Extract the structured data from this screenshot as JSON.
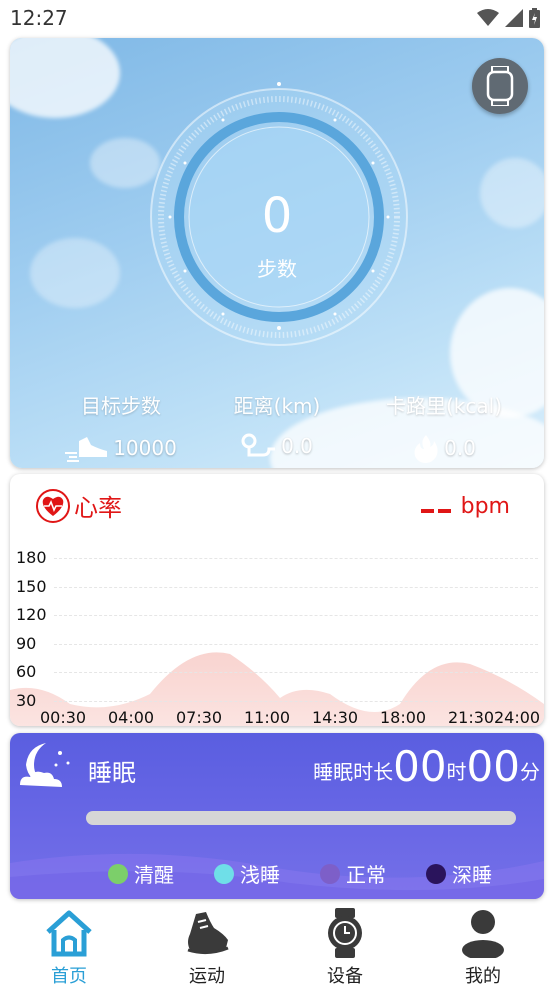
{
  "status_bar": {
    "time": "12:27"
  },
  "steps": {
    "value": "0",
    "label": "步数",
    "stats": [
      {
        "label": "目标步数",
        "value": "10000",
        "icon": "shoe-icon"
      },
      {
        "label": "距离(km)",
        "value": "0.0",
        "icon": "route-icon"
      },
      {
        "label": "卡路里(kcal)",
        "value": "0.0",
        "icon": "flame-icon"
      }
    ]
  },
  "heart_rate": {
    "title": "心率",
    "unit": "bpm",
    "value_placeholder": "--"
  },
  "chart_data": {
    "type": "area",
    "title": "",
    "y_ticks": [
      180,
      150,
      120,
      90,
      60,
      30
    ],
    "x_ticks": [
      "00:30",
      "04:00",
      "07:30",
      "11:00",
      "14:30",
      "18:00",
      "21:30",
      "24:00"
    ],
    "ylim": [
      30,
      180
    ],
    "series": []
  },
  "sleep": {
    "title": "睡眠",
    "duration_label": "睡眠时长",
    "hours": "00",
    "hours_unit": "时",
    "minutes": "00",
    "minutes_unit": "分",
    "legend": [
      {
        "label": "清醒",
        "color": "#7ccf6a"
      },
      {
        "label": "浅睡",
        "color": "#6fdfe8"
      },
      {
        "label": "正常",
        "color": "#7d5fc8"
      },
      {
        "label": "深睡",
        "color": "#2a145c"
      }
    ]
  },
  "nav": {
    "items": [
      {
        "label": "首页",
        "icon": "home-icon",
        "active": true
      },
      {
        "label": "运动",
        "icon": "running-shoe-icon",
        "active": false
      },
      {
        "label": "设备",
        "icon": "watch-icon",
        "active": false
      },
      {
        "label": "我的",
        "icon": "person-icon",
        "active": false
      }
    ],
    "active_color": "#2a9fd6"
  }
}
